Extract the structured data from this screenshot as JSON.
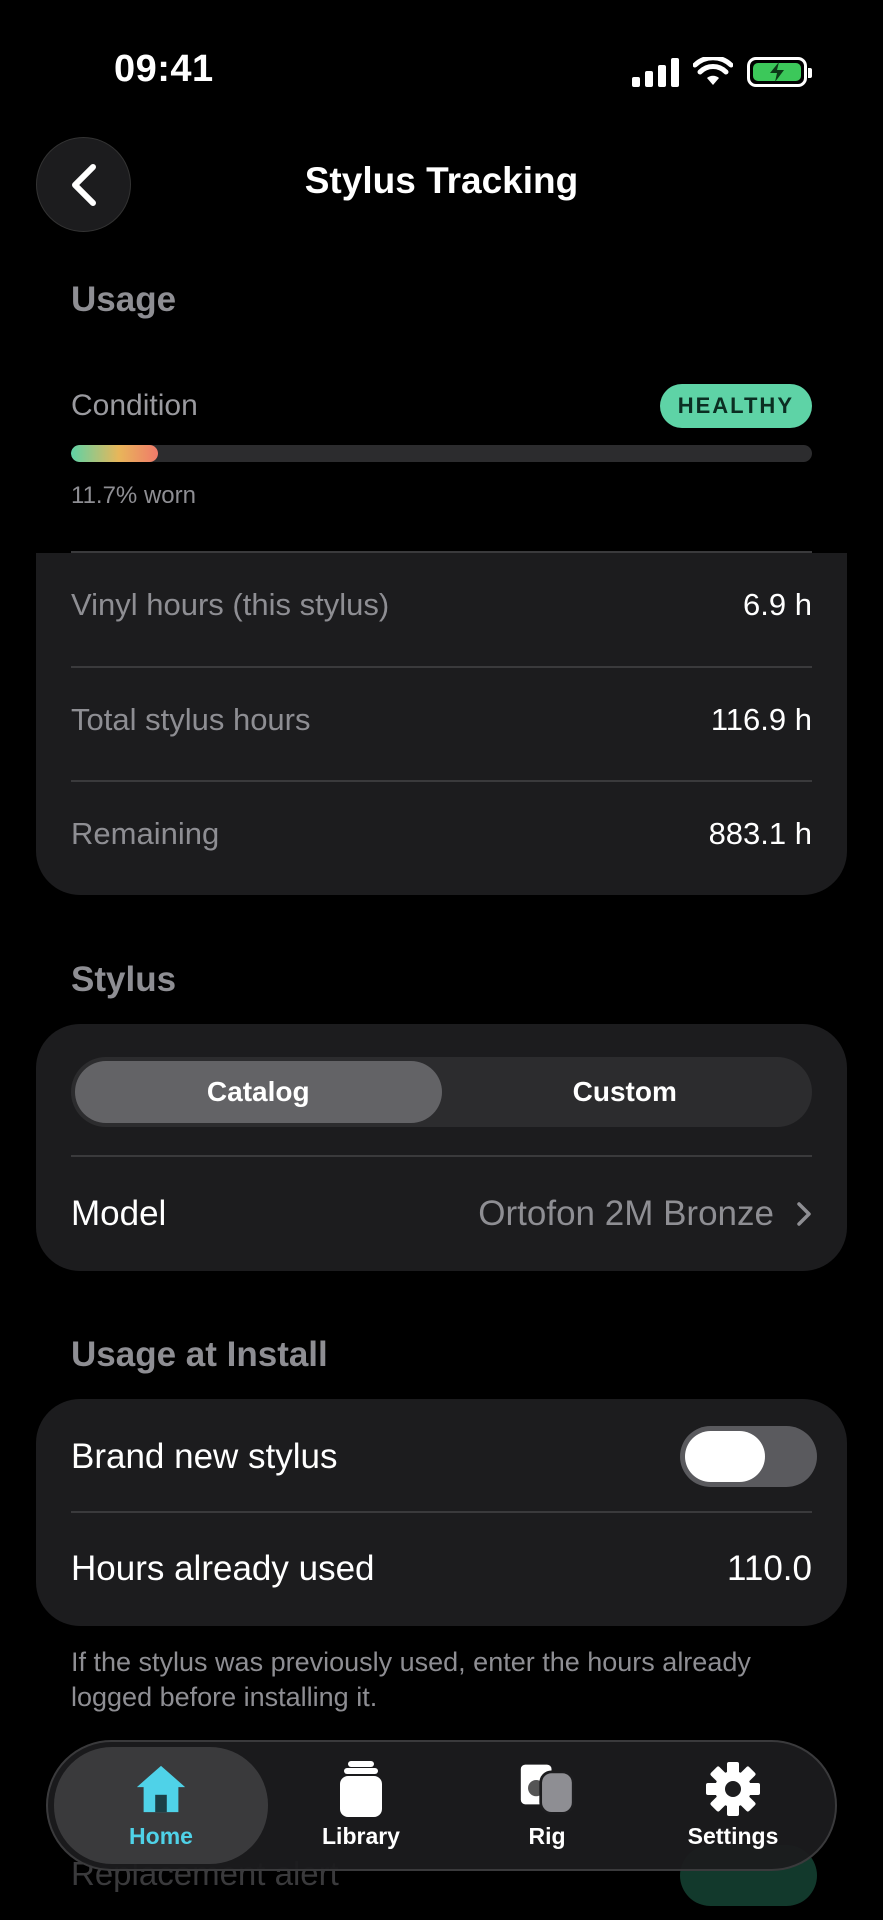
{
  "status": {
    "time": "09:41"
  },
  "header": {
    "title": "Stylus Tracking"
  },
  "usage": {
    "section_title": "Usage",
    "condition_label": "Condition",
    "condition_badge": "HEALTHY",
    "worn_percent": 11.7,
    "worn_text": "11.7% worn",
    "stats": [
      {
        "label": "Vinyl hours (this stylus)",
        "value": "6.9 h"
      },
      {
        "label": "Total stylus hours",
        "value": "116.9 h"
      },
      {
        "label": "Remaining",
        "value": "883.1 h"
      }
    ]
  },
  "stylus": {
    "section_title": "Stylus",
    "segments": [
      "Catalog",
      "Custom"
    ],
    "selected_segment": "Catalog",
    "model_label": "Model",
    "model_value": "Ortofon 2M Bronze"
  },
  "install": {
    "section_title": "Usage at Install",
    "brand_new_label": "Brand new stylus",
    "brand_new_on": false,
    "hours_label": "Hours already used",
    "hours_value": "110.0",
    "footnote": "If the stylus was previously used, enter the hours already logged before installing it."
  },
  "peek": {
    "replacement_label": "Replacement alert"
  },
  "tabbar": {
    "tabs": [
      {
        "label": "Home",
        "icon": "house-icon",
        "active": true
      },
      {
        "label": "Library",
        "icon": "record-stack-icon",
        "active": false
      },
      {
        "label": "Rig",
        "icon": "speaker-icon",
        "active": false
      },
      {
        "label": "Settings",
        "icon": "gear-icon",
        "active": false
      }
    ]
  },
  "colors": {
    "accent_tab": "#4fd2e8",
    "healthy_badge": "#5ed3a6",
    "battery": "#3cc85a",
    "card_bg": "#1c1c1e"
  }
}
